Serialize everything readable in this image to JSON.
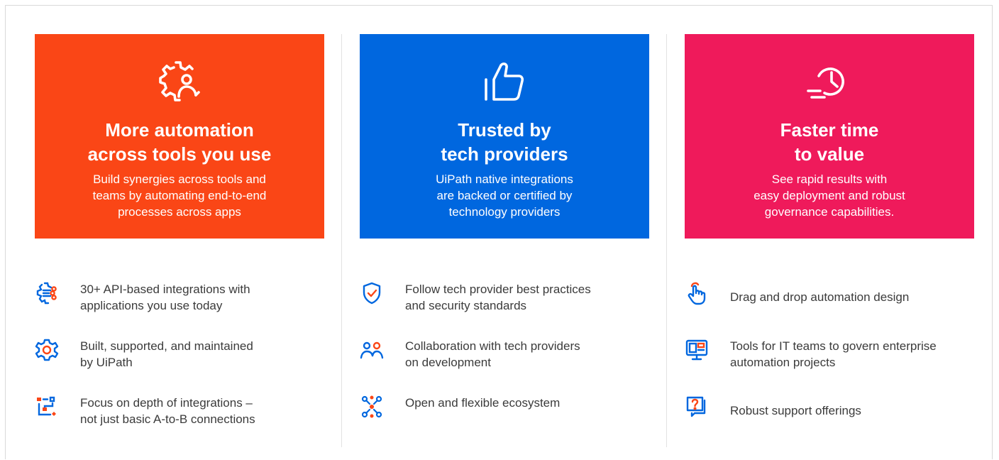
{
  "colors": {
    "orange": "#fa4616",
    "blue": "#0067df",
    "pink": "#ef1a5b",
    "icon_blue": "#0067df",
    "icon_orange": "#fa4616"
  },
  "columns": [
    {
      "card": {
        "icon": "gear-person-icon",
        "title": "More automation\nacross tools you use",
        "description": "Build synergies across tools and\nteams by automating end-to-end\nprocesses across apps"
      },
      "features": [
        {
          "icon": "api-gear-icon",
          "text": "30+ API-based integrations with\napplications you use today"
        },
        {
          "icon": "gear-icon",
          "text": "Built, supported, and maintained\nby UiPath"
        },
        {
          "icon": "flow-connections-icon",
          "text": "Focus on depth of integrations –\nnot just basic A-to-B connections"
        }
      ]
    },
    {
      "card": {
        "icon": "thumbs-up-icon",
        "title": "Trusted by\ntech providers",
        "description": "UiPath native integrations\nare backed or certified by\ntechnology providers"
      },
      "features": [
        {
          "icon": "shield-check-icon",
          "text": "Follow tech provider best practices\nand security standards"
        },
        {
          "icon": "people-icon",
          "text": "Collaboration with tech providers\non development"
        },
        {
          "icon": "ecosystem-network-icon",
          "text": "Open and flexible ecosystem"
        }
      ]
    },
    {
      "card": {
        "icon": "fast-clock-icon",
        "title": "Faster time\nto value",
        "description": "See rapid results with\neasy deployment and robust\ngovernance capabilities."
      },
      "features": [
        {
          "icon": "pointer-hand-icon",
          "text": "Drag and drop automation design"
        },
        {
          "icon": "monitor-dashboard-icon",
          "text": "Tools for IT teams to govern enterprise\nautomation projects"
        },
        {
          "icon": "help-chat-icon",
          "text": "Robust support offerings"
        }
      ]
    }
  ]
}
